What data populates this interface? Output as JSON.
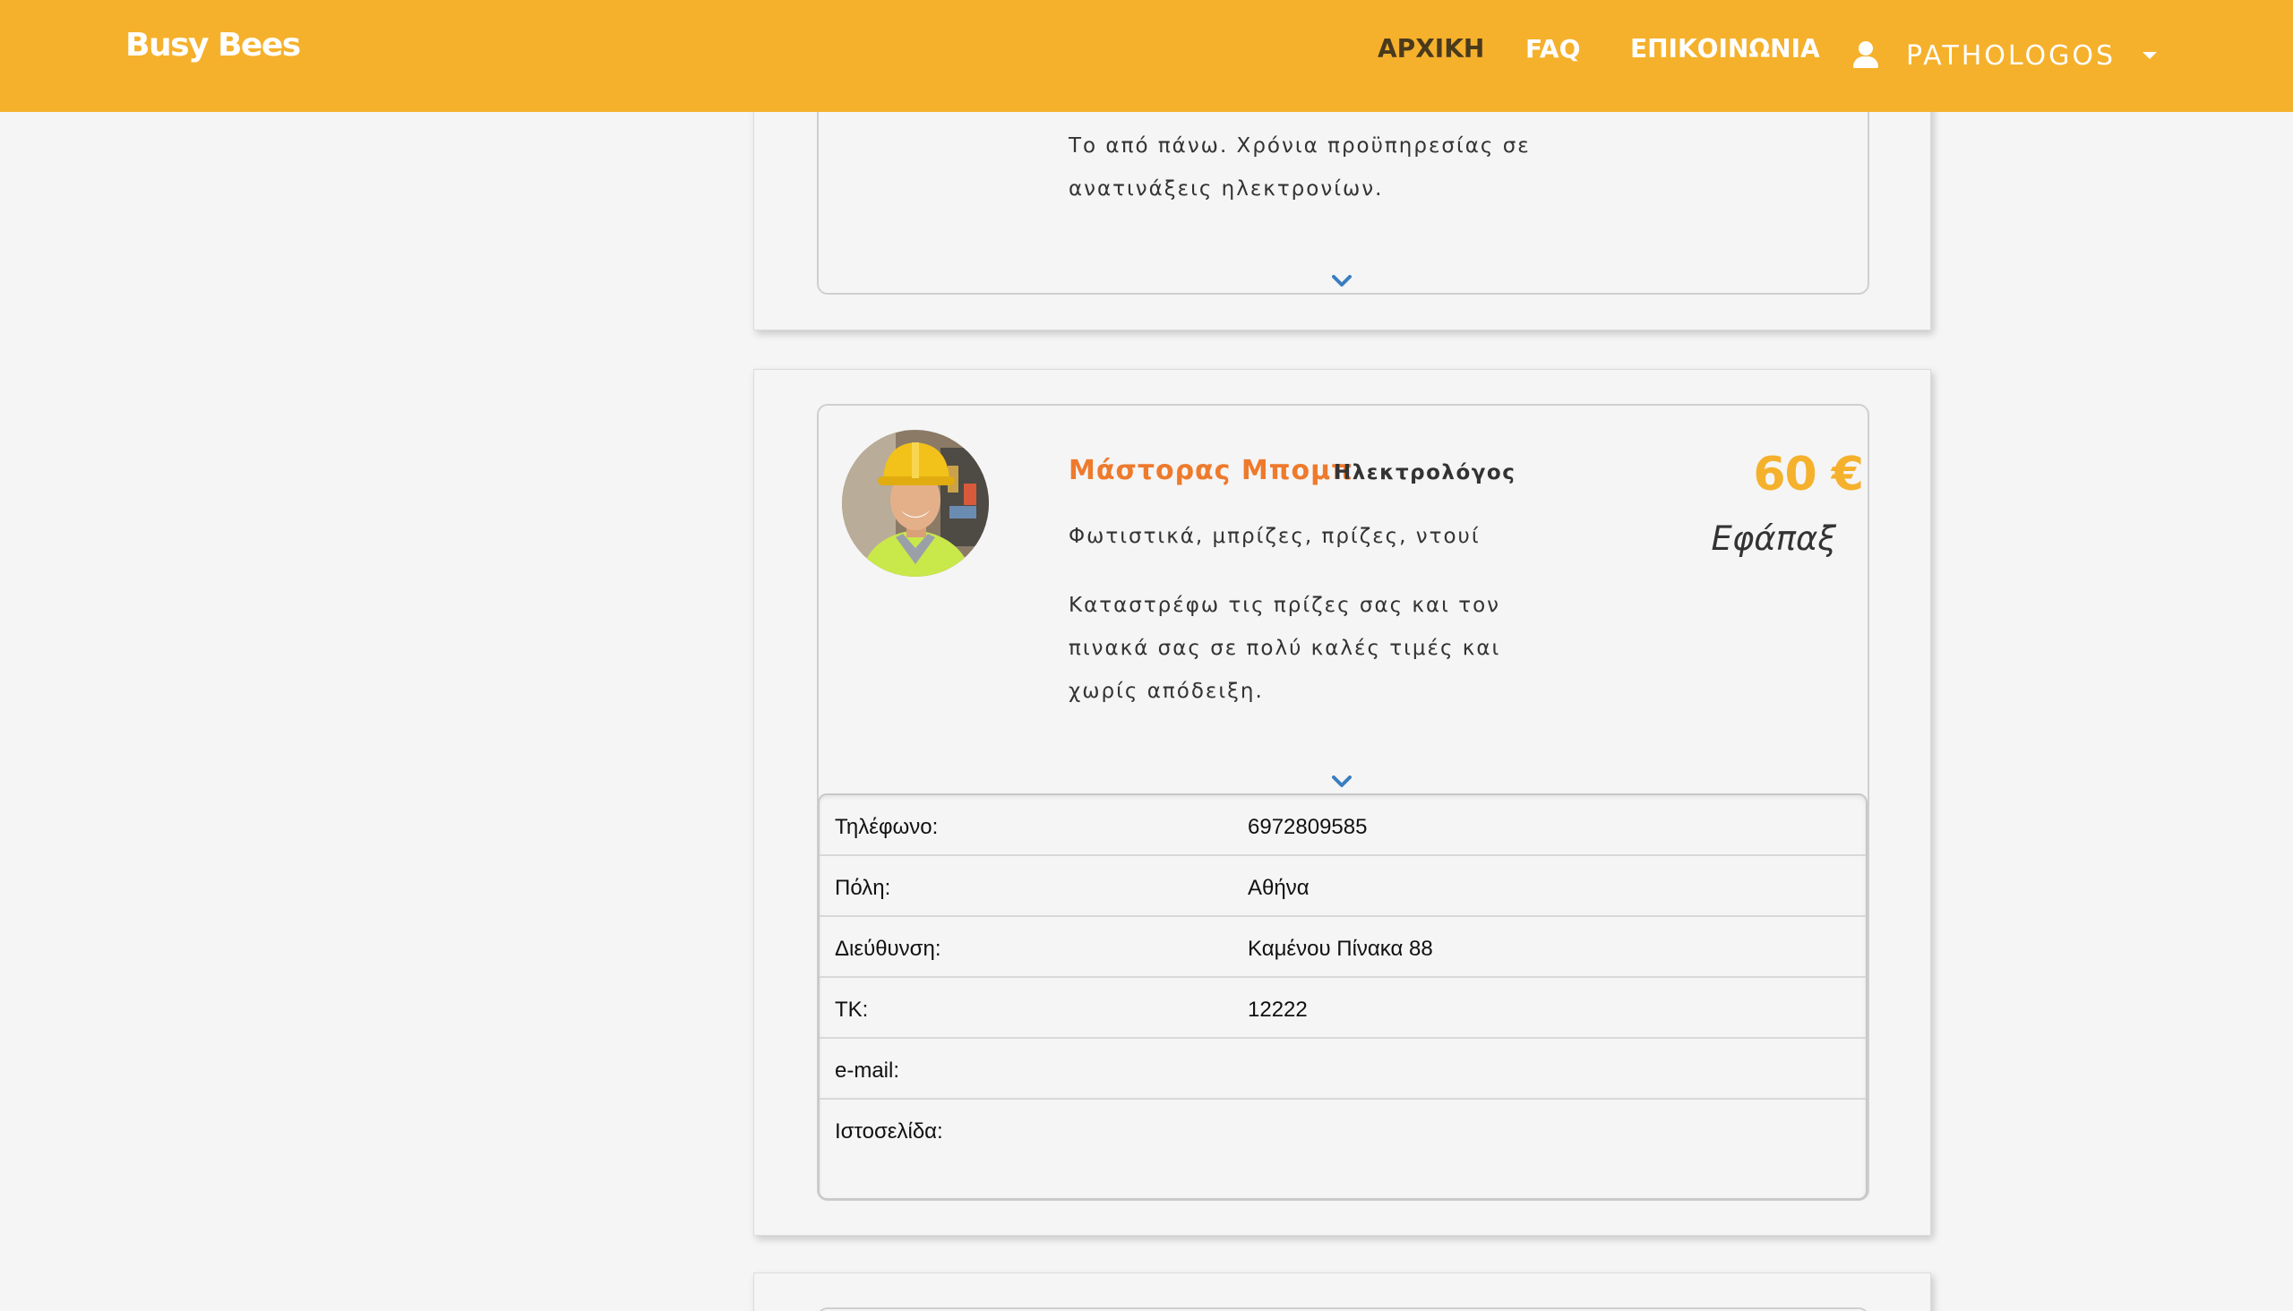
{
  "navbar": {
    "brand": "Busy Bees",
    "links": [
      {
        "label": "ΑΡΧΙΚΗ",
        "active": true
      },
      {
        "label": "FAQ",
        "active": false
      },
      {
        "label": "ΕΠΙΚΟΙΝΩΝΙΑ",
        "active": false
      }
    ],
    "user": {
      "name": "PATHOLOGOS",
      "icon": "user-icon",
      "caret_icon": "caret-down-icon"
    },
    "background_color": "#f5b12c"
  },
  "previous_card": {
    "description": "Το από πάνω. Χρόνια προϋπηρεσίας σε ανατινάξεις ηλεκτρονίων.",
    "expand_icon": "chevron-down-icon"
  },
  "professional": {
    "name": "Μάστορας Μπομπ",
    "role": "Ηλεκτρολόγος",
    "tags": "Φωτιστικά, μπρίζες, πρίζες, ντουί",
    "description": "Καταστρέφω τις πρίζες σας και τον πινακά σας σε πολύ καλές τιμές και χωρίς απόδειξη.",
    "price": "60 €",
    "price_type": "Εφάπαξ",
    "avatar_icon": "worker-avatar",
    "expand_icon": "chevron-down-icon",
    "name_color": "#ee7a2c",
    "price_color": "#f5b12c"
  },
  "details": {
    "rows": [
      {
        "label": "Τηλέφωνο:",
        "value": "6972809585"
      },
      {
        "label": "Πόλη:",
        "value": "Αθήνα"
      },
      {
        "label": "Διεύθυνση:",
        "value": "Καμένου Πίνακα 88"
      },
      {
        "label": "ΤΚ:",
        "value": "12222"
      },
      {
        "label": "e-mail:",
        "value": ""
      },
      {
        "label": "Ιστοσελίδα:",
        "value": ""
      }
    ]
  }
}
